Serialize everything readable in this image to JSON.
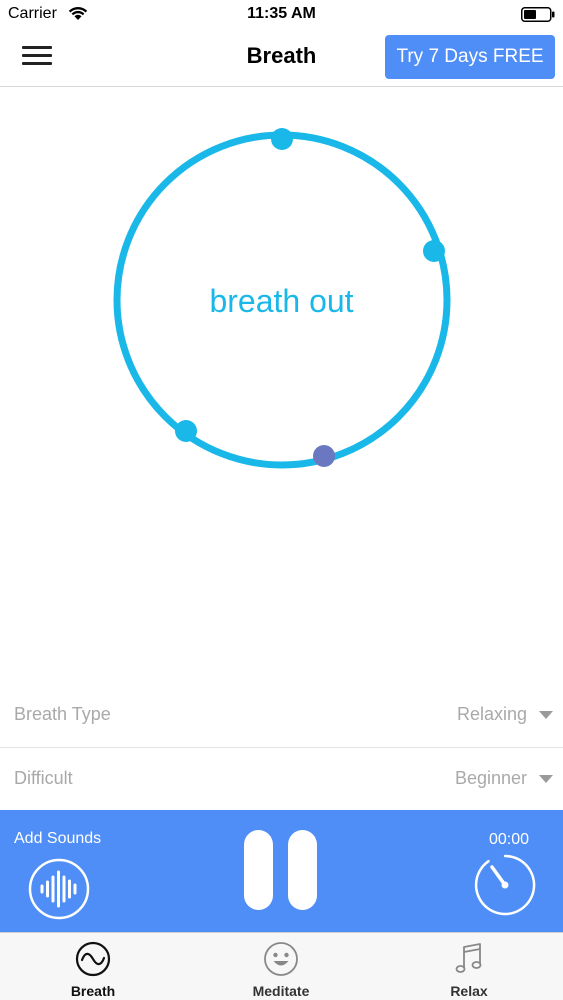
{
  "status_bar": {
    "carrier": "Carrier",
    "time": "11:35 AM",
    "wifi_icon": "wifi-icon",
    "battery_icon": "battery-icon"
  },
  "nav": {
    "title": "Breath",
    "menu_icon": "hamburger-menu-icon",
    "trial_button": "Try 7 Days FREE"
  },
  "breath": {
    "phase_text": "breath out",
    "ring_color": "#1ab8e8",
    "indicator_color": "#6a78c2"
  },
  "settings": {
    "breath_type": {
      "label": "Breath Type",
      "value": "Relaxing"
    },
    "difficult": {
      "label": "Difficult",
      "value": "Beginner"
    }
  },
  "player": {
    "add_sounds_label": "Add Sounds",
    "sound_icon": "sound-wave-icon",
    "pause_icon": "pause-icon",
    "timer": "00:00",
    "timer_icon": "stopwatch-icon"
  },
  "tabs": [
    {
      "label": "Breath",
      "icon": "wave-circle-icon",
      "active": true
    },
    {
      "label": "Meditate",
      "icon": "smiley-icon",
      "active": false
    },
    {
      "label": "Relax",
      "icon": "music-note-icon",
      "active": false
    }
  ],
  "colors": {
    "accent": "#4f8ef7",
    "ring": "#1ab8e8",
    "setting_text": "#a9a9a9"
  }
}
